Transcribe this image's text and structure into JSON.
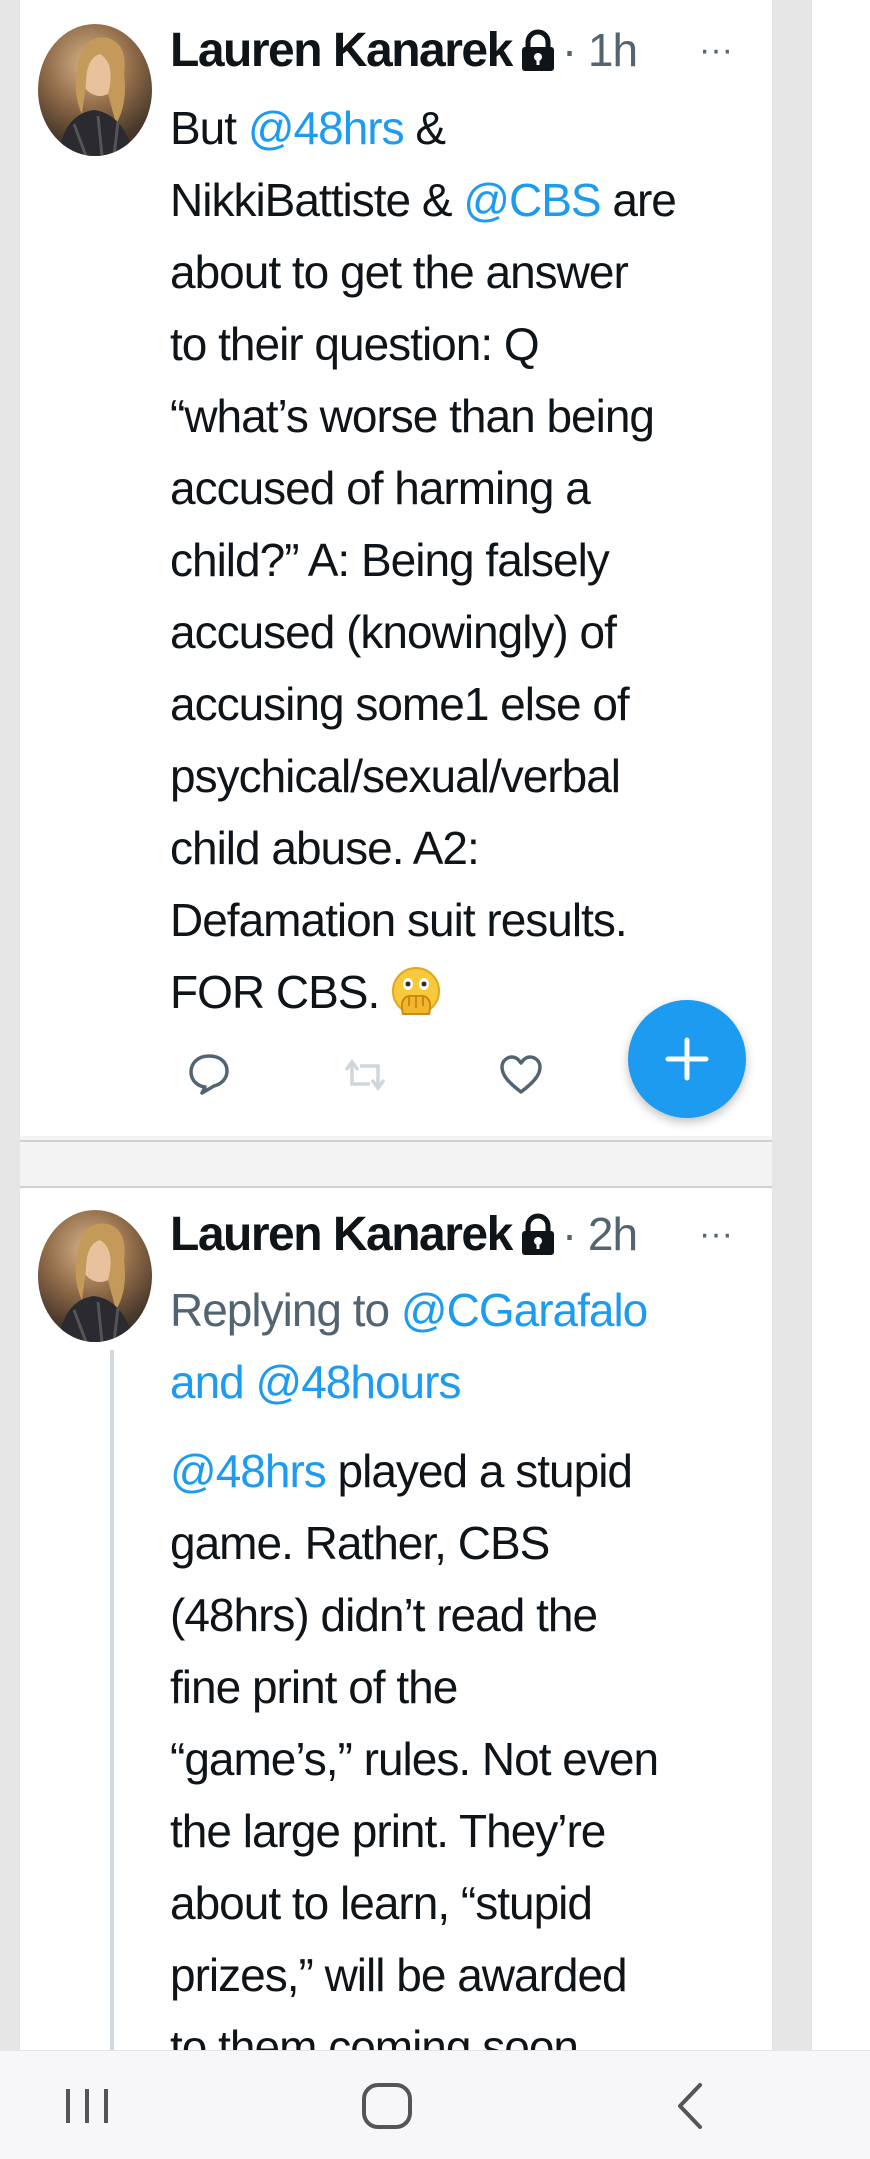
{
  "tweets": [
    {
      "author": "Lauren Kanarek",
      "time": "· 1h",
      "more": "···",
      "body": {
        "t1": "But ",
        "m1": "@48hrs",
        "t2": " &\nNikkiBattiste & ",
        "m2": "@CBS",
        "t3": " are\nabout to get the answer\nto their question: Q\n“what’s worse than being\naccused of harming a\nchild?” A: Being falsely\naccused (knowingly) of\naccusing some1 else of\npsychical/sexual/verbal\nchild abuse. A2:\nDefamation suit results.\nFOR CBS. "
      }
    },
    {
      "author": "Lauren Kanarek",
      "time": "· 2h",
      "more": "···",
      "reply_prefix": "Replying to ",
      "reply_to_1": "@CGarafalo",
      "reply_joiner": "and ",
      "reply_to_2": "@48hours",
      "body": {
        "m1": "@48hrs",
        "t1": " played a stupid\ngame. Rather, CBS\n(48hrs) didn’t read the\nfine print of the\n“game’s,” rules. Not even\nthe large print.  They’re\nabout to learn, “stupid\nprizes,” will be awarded\nto them coming soon."
      }
    }
  ],
  "icons": {
    "lock": "lock-icon",
    "emoji": "face-with-open-eyes-and-hand-over-mouth-icon",
    "reply": "reply-icon",
    "retweet": "retweet-icon",
    "like": "heart-icon",
    "compose": "plus-icon",
    "recent_apps": "recent-apps-icon",
    "home": "home-icon",
    "back": "back-icon"
  },
  "colors": {
    "accent": "#1d9bf0",
    "text": "#0f1419",
    "muted": "#536471"
  }
}
